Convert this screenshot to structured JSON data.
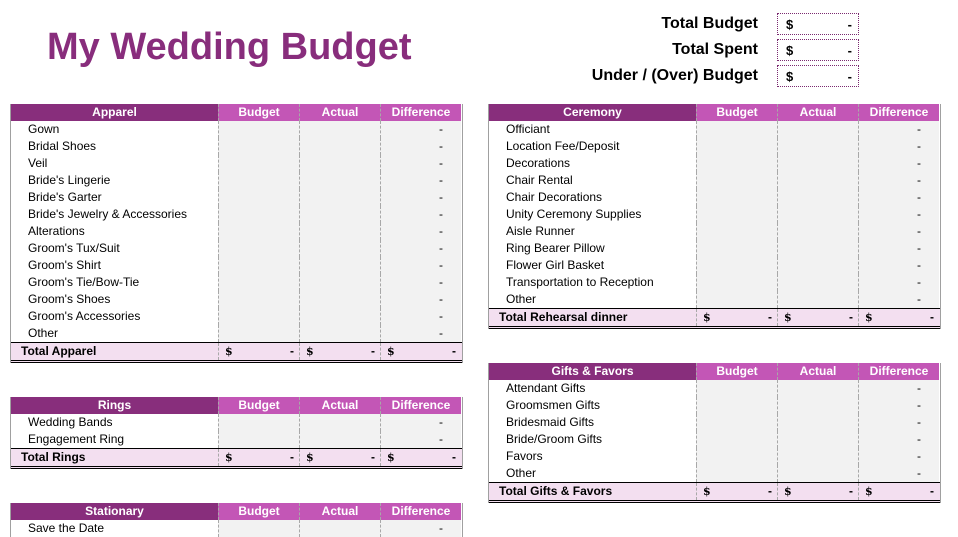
{
  "title": "My Wedding Budget",
  "summary": [
    {
      "label": "Total Budget",
      "currency": "$",
      "value": "-"
    },
    {
      "label": "Total Spent",
      "currency": "$",
      "value": "-"
    },
    {
      "label": "Under / (Over) Budget",
      "currency": "$",
      "value": "-"
    }
  ],
  "columns": [
    "Budget",
    "Actual",
    "Difference"
  ],
  "colors": {
    "header_dark": "#882e7c",
    "header_light": "#c356b6",
    "total_row": "#f3dff0",
    "value_cell": "#f2f2f2",
    "title": "#882d7c"
  },
  "tables": {
    "apparel": {
      "title": "Apparel",
      "items": [
        "Gown",
        "Bridal Shoes",
        "Veil",
        "Bride's Lingerie",
        "Bride's Garter",
        "Bride's Jewelry & Accessories",
        "Alterations",
        "Groom's Tux/Suit",
        "Groom's Shirt",
        "Groom's Tie/Bow-Tie",
        "Groom's Shoes",
        "Groom's Accessories",
        "Other"
      ],
      "difference": "-",
      "total_label": "Total Apparel",
      "total": {
        "currency": "$",
        "value": "-"
      }
    },
    "rings": {
      "title": "Rings",
      "items": [
        "Wedding Bands",
        "Engagement Ring"
      ],
      "difference": "-",
      "total_label": "Total Rings",
      "total": {
        "currency": "$",
        "value": "-"
      }
    },
    "stationary": {
      "title": "Stationary",
      "items": [
        "Save the Date"
      ],
      "difference": "-"
    },
    "ceremony": {
      "title": "Ceremony",
      "items": [
        "Officiant",
        "Location Fee/Deposit",
        "Decorations",
        "Chair Rental",
        "Chair Decorations",
        "Unity Ceremony Supplies",
        "Aisle Runner",
        "Ring Bearer Pillow",
        "Flower Girl Basket",
        "Transportation to Reception",
        "Other"
      ],
      "difference": "-",
      "total_label": "Total Rehearsal dinner",
      "total": {
        "currency": "$",
        "value": "-"
      }
    },
    "gifts": {
      "title": "Gifts & Favors",
      "items": [
        "Attendant Gifts",
        "Groomsmen Gifts",
        "Bridesmaid Gifts",
        "Bride/Groom Gifts",
        "Favors",
        "Other"
      ],
      "difference": "-",
      "total_label": "Total Gifts & Favors",
      "total": {
        "currency": "$",
        "value": "-"
      }
    }
  }
}
